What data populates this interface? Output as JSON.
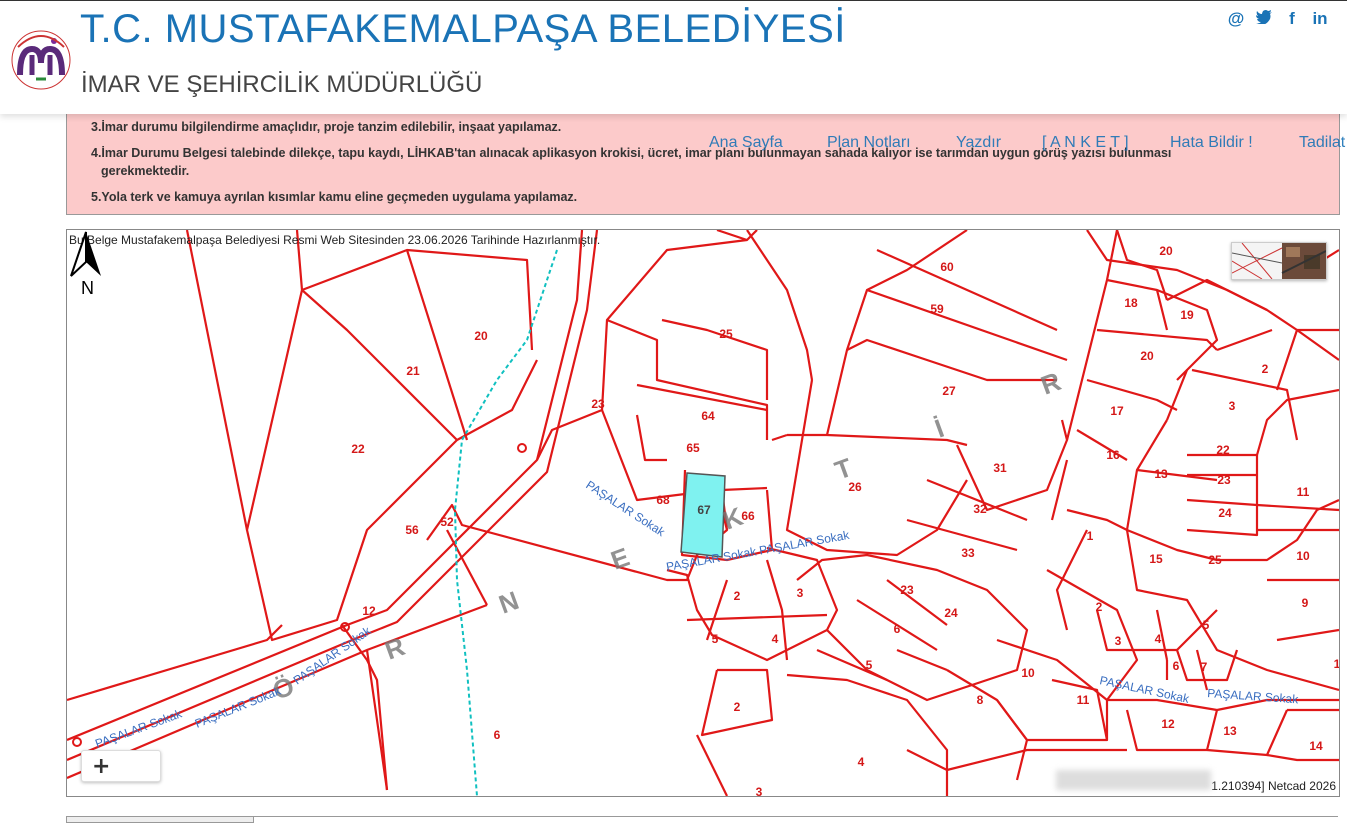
{
  "header": {
    "title": "T.C. MUSTAFAKEMALPAŞA BELEDİYESİ",
    "subtitle": "İMAR VE ŞEHİRCİLİK MÜDÜRLÜĞÜ",
    "logo_text": "MUSTAFAKEMALPAŞA BELEDİYESİ",
    "social": [
      "@",
      "twitter",
      "f",
      "in"
    ]
  },
  "nav": [
    "Ana Sayfa",
    "Plan Notları",
    "Yazdır",
    "[ A N K E T ]",
    "Hata Bildir !",
    "Tadilat"
  ],
  "notes": [
    "3.İmar durumu bilgilendirme amaçlıdır, proje tanzim edilebilir, inşaat yapılamaz.",
    "4.İmar Durumu Belgesi talebinde dilekçe, tapu kaydı, LİHKAB'tan alınacak aplikasyon krokisi, ücret, imar planı bulunmayan sahada kalıyor ise tarımdan uygun görüş yazısı bulunması",
    "gerekmektedir.",
    "5.Yola terk ve kamuya ayrılan kısımlar kamu eline geçmeden uygulama yapılamaz."
  ],
  "map": {
    "caption": "Bu Belge Mustafakemalpaşa Belediyesi Resmi Web Sitesinden 23.06.2026 Tarihinde Hazırlanmıştır.",
    "zoom_in": "+",
    "coords_suffix": "1.210394] Netcad 2026",
    "north": "N",
    "highlight_parcel": "67",
    "parcel_labels": [
      "20",
      "21",
      "22",
      "23",
      "25",
      "64",
      "65",
      "68",
      "67",
      "66",
      "56",
      "52",
      "12",
      "60",
      "59",
      "27",
      "26",
      "31",
      "32",
      "33",
      "20",
      "18",
      "19",
      "20",
      "17",
      "16",
      "13",
      "22",
      "23",
      "24",
      "2",
      "3",
      "11",
      "10",
      "9",
      "1",
      "15",
      "25",
      "2",
      "3",
      "4",
      "5",
      "6",
      "7",
      "23",
      "24",
      "6",
      "5",
      "8",
      "10",
      "11",
      "12",
      "13",
      "14",
      "2",
      "3",
      "4",
      "5",
      "2",
      "4",
      "6",
      "3",
      "1"
    ],
    "district_letters": [
      "Ö",
      "R",
      "N",
      "E",
      "K",
      "T",
      "İ",
      "R"
    ],
    "street_labels": [
      "PAŞALAR Sokak",
      "PAŞALAR Sokak PAŞALAR Sokak",
      "PAŞALAR Sokak",
      "PAŞALAR Sokak",
      "PAŞALAR Sokak",
      "PAŞALAR Sokak",
      "PAŞALAR Sokak"
    ]
  }
}
